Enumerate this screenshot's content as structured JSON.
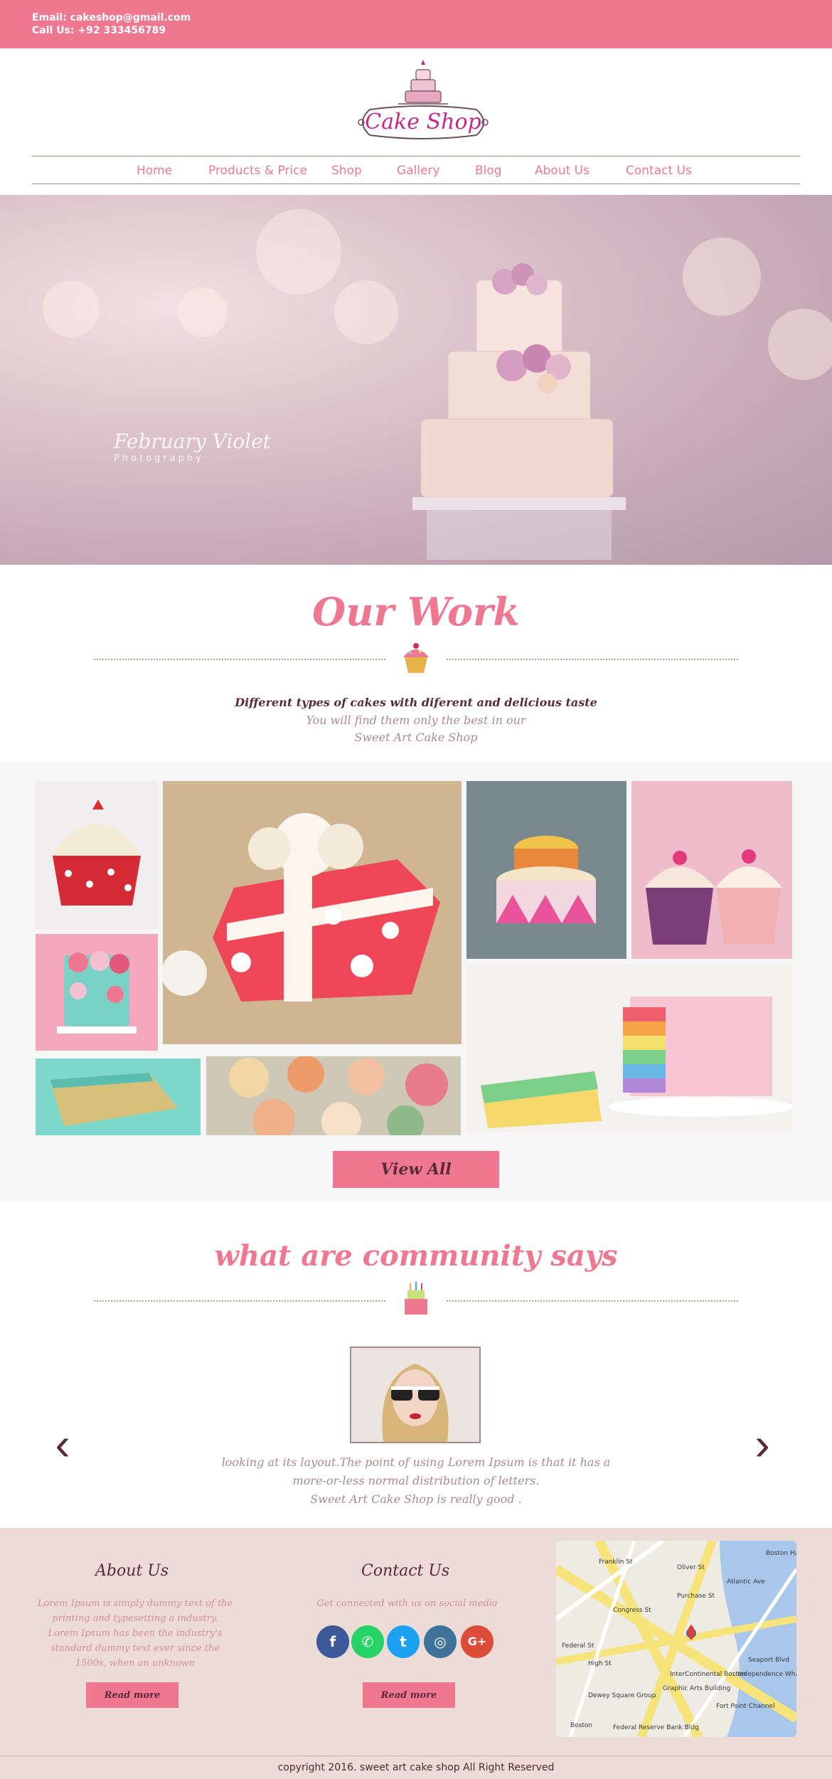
{
  "topbar": {
    "email": "Email: cakeshop@gmail.com",
    "phone": "Call Us: +92 333456789"
  },
  "logo": {
    "text": "Cake Shop"
  },
  "nav": {
    "items": [
      "Home",
      "Products & Price",
      "Shop",
      "Gallery",
      "Blog",
      "About Us",
      "Contact Us"
    ]
  },
  "hero": {
    "watermark_name": "February Violet",
    "watermark_sub": "Photography"
  },
  "our_work": {
    "title": "Our Work",
    "line1": "Different types of cakes with diferent and delicious taste",
    "line2": "You will find them only the best in our",
    "line3": "Sweet Art Cake Shop",
    "view_all": "View All"
  },
  "community": {
    "title": "what are community says",
    "quote_line1": "looking at its layout.The point of using Lorem Ipsum is that it has a",
    "quote_line2": "more-or-less normal distribution of letters.",
    "quote_line3": "Sweet Art Cake Shop is really good ."
  },
  "footer": {
    "about_title": "About Us",
    "about_text": "Lorem Ipsum is simply dummy text of the printing and typesetting a industry. Lorem Ipsum has been the industry's standard dummy text ever since the 1500s, when an unknown",
    "about_button": "Read more",
    "contact_title": "Contact Us",
    "contact_text": "Get connected with us on social media",
    "contact_button": "Read more",
    "social": [
      {
        "icon": "facebook-icon",
        "glyph": "f",
        "color": "#3b5998"
      },
      {
        "icon": "whatsapp-icon",
        "glyph": "✆",
        "color": "#25d366"
      },
      {
        "icon": "twitter-icon",
        "glyph": "t",
        "color": "#1da1f2"
      },
      {
        "icon": "instagram-icon",
        "glyph": "◎",
        "color": "#3f729b"
      },
      {
        "icon": "google-plus-icon",
        "glyph": "G+",
        "color": "#dd4b39"
      }
    ],
    "map_labels": [
      "Franklin St",
      "Congress St",
      "Federal St",
      "High St",
      "Purchase St",
      "Atlantic Ave",
      "Oliver St",
      "Seaport Blvd",
      "Boston Harbor Hotel",
      "InterContinental Boston",
      "Independence Wharf",
      "Graphic Arts Building",
      "Dewey Square Group",
      "Fort Point Channel",
      "Boston",
      "Federal Reserve Bank Bldg"
    ]
  },
  "copyright": "copyright 2016. sweet art cake shop All Right Reserved",
  "colors": {
    "accent": "#ef7890",
    "dark": "#5a2a3a",
    "footer_bg": "#ecdbd6"
  }
}
